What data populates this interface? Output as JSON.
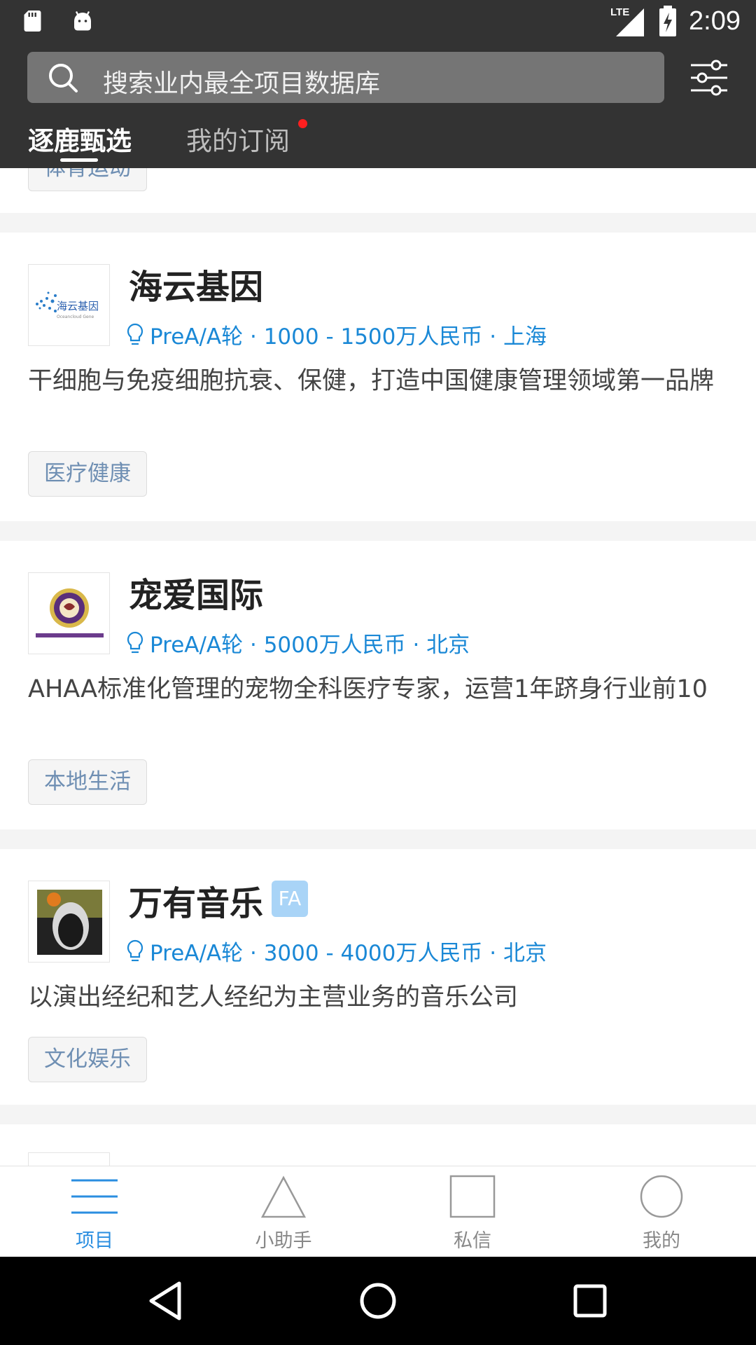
{
  "status_bar": {
    "network": "LTE",
    "time": "2:09"
  },
  "search": {
    "placeholder": "搜索业内最全项目数据库"
  },
  "tabs": [
    {
      "label": "逐鹿甄选",
      "active": true
    },
    {
      "label": "我的订阅",
      "active": false,
      "has_notification": true
    }
  ],
  "partial_top_tag": "体育运动",
  "projects": [
    {
      "name": "海云基因",
      "fa": false,
      "meta": "PreA/A轮 · 1000 - 1500万人民币 · 上海",
      "description": "干细胞与免疫细胞抗衰、保健，打造中国健康管理领域第一品牌",
      "tag": "医疗健康",
      "logo_text": "海云基因",
      "logo_subtext": "Oceancloud Gene"
    },
    {
      "name": "宠爱国际",
      "fa": false,
      "meta": "PreA/A轮 · 5000万人民币 · 北京",
      "description": "AHAA标准化管理的宠物全科医疗专家，运营1年跻身行业前10",
      "tag": "本地生活"
    },
    {
      "name": "万有音乐",
      "fa": true,
      "fa_label": "FA",
      "meta": "PreA/A轮 · 3000 - 4000万人民币 · 北京",
      "description": "以演出经纪和艺人经纪为主营业务的音乐公司",
      "tag": "文化娱乐"
    }
  ],
  "bottom_nav": [
    {
      "label": "项目",
      "icon": "menu-lines-icon",
      "active": true
    },
    {
      "label": "小助手",
      "icon": "triangle-icon",
      "active": false
    },
    {
      "label": "私信",
      "icon": "square-icon",
      "active": false
    },
    {
      "label": "我的",
      "icon": "circle-icon",
      "active": false
    }
  ],
  "colors": {
    "header_bg": "#333333",
    "accent": "#1a88d6",
    "notification": "#ff1f1f",
    "fa_badge": "#a9d4f7"
  }
}
